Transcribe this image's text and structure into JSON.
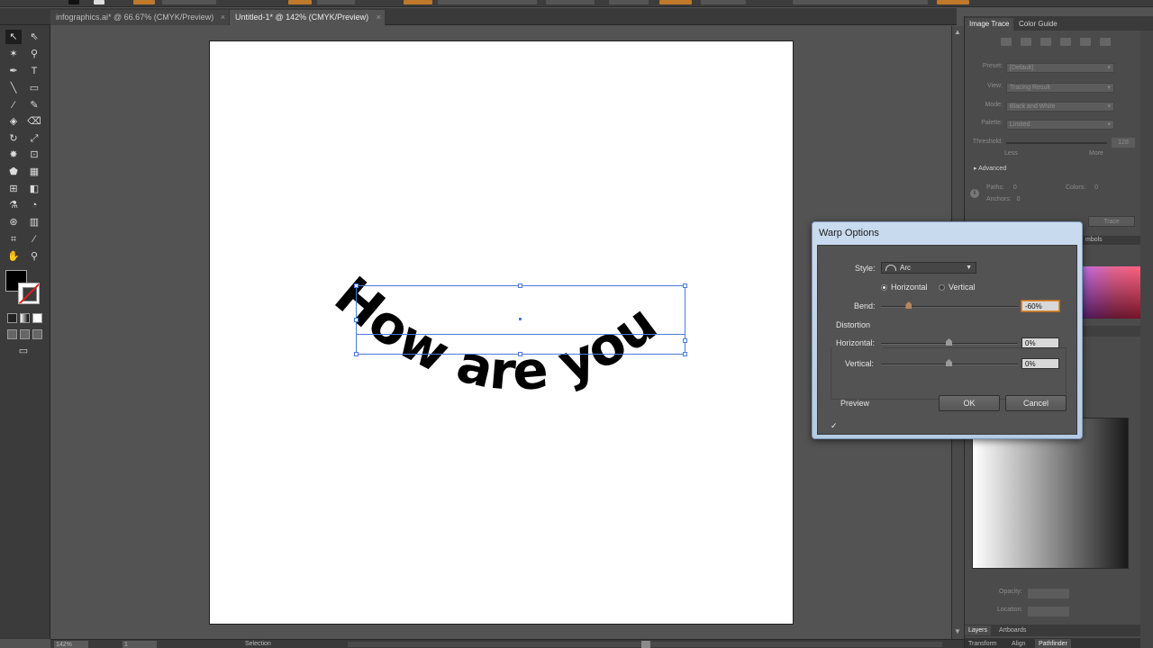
{
  "tabs": [
    {
      "label": "infographics.ai* @ 66.67% (CMYK/Preview)",
      "close": "×"
    },
    {
      "label": "Untitled-1* @ 142% (CMYK/Preview)",
      "close": "×"
    }
  ],
  "tools": {
    "glyphs": [
      "↖",
      "⇖",
      "✶",
      "⚲",
      "✒",
      "T",
      "╲",
      "▭",
      "⁄",
      "✎",
      "◈",
      "⌫",
      "↻",
      "⤢",
      "✸",
      "⊡",
      "⬟",
      "▦",
      "⊞",
      "◧",
      "⚗",
      "◔",
      "⊛",
      "▥",
      "⌗",
      "⁄",
      "✋",
      "⚲"
    ],
    "screen_mode": "▭"
  },
  "canvas": {
    "warped_text": "How are you"
  },
  "right_panel": {
    "tabs": [
      "Image Trace",
      "Color Guide"
    ],
    "preset": {
      "label": "Preset:",
      "value": "[Default]"
    },
    "view": {
      "label": "View:",
      "value": "Tracing Result"
    },
    "mode": {
      "label": "Mode:",
      "value": "Black and White"
    },
    "palette": {
      "label": "Palette:",
      "value": "Limited"
    },
    "threshold": {
      "label": "Threshold:",
      "value": "128",
      "less": "Less",
      "more": "More"
    },
    "advanced": "Advanced",
    "paths": {
      "label": "Paths:",
      "value": "0"
    },
    "colors": {
      "label": "Colors:",
      "value": "0"
    },
    "anchors": {
      "label": "Anchors:",
      "value": "0"
    },
    "trace_button": "Trace",
    "symbols_tab": "mbols",
    "opacity_label": "Opacity:",
    "location_label": "Location:",
    "bottom_tabs_1": [
      "Layers",
      "Artboards"
    ],
    "bottom_tabs_2": [
      "Transform",
      "Align",
      "Pathfinder"
    ]
  },
  "status": {
    "zoom": "142%",
    "page": "1",
    "mode_label": "Selection"
  },
  "dialog": {
    "title": "Warp Options",
    "style_label": "Style:",
    "style_value": "Arc",
    "orientation_horizontal": "Horizontal",
    "orientation_vertical": "Vertical",
    "orientation_selected": "horizontal",
    "bend_label": "Bend:",
    "bend_value": "-60%",
    "bend": -60,
    "distortion_label": "Distortion",
    "dist_h_label": "Horizontal:",
    "dist_h_value": "0%",
    "dist_v_label": "Vertical:",
    "dist_v_value": "0%",
    "preview_label": "Preview",
    "preview_checked": true,
    "ok": "OK",
    "cancel": "Cancel"
  }
}
